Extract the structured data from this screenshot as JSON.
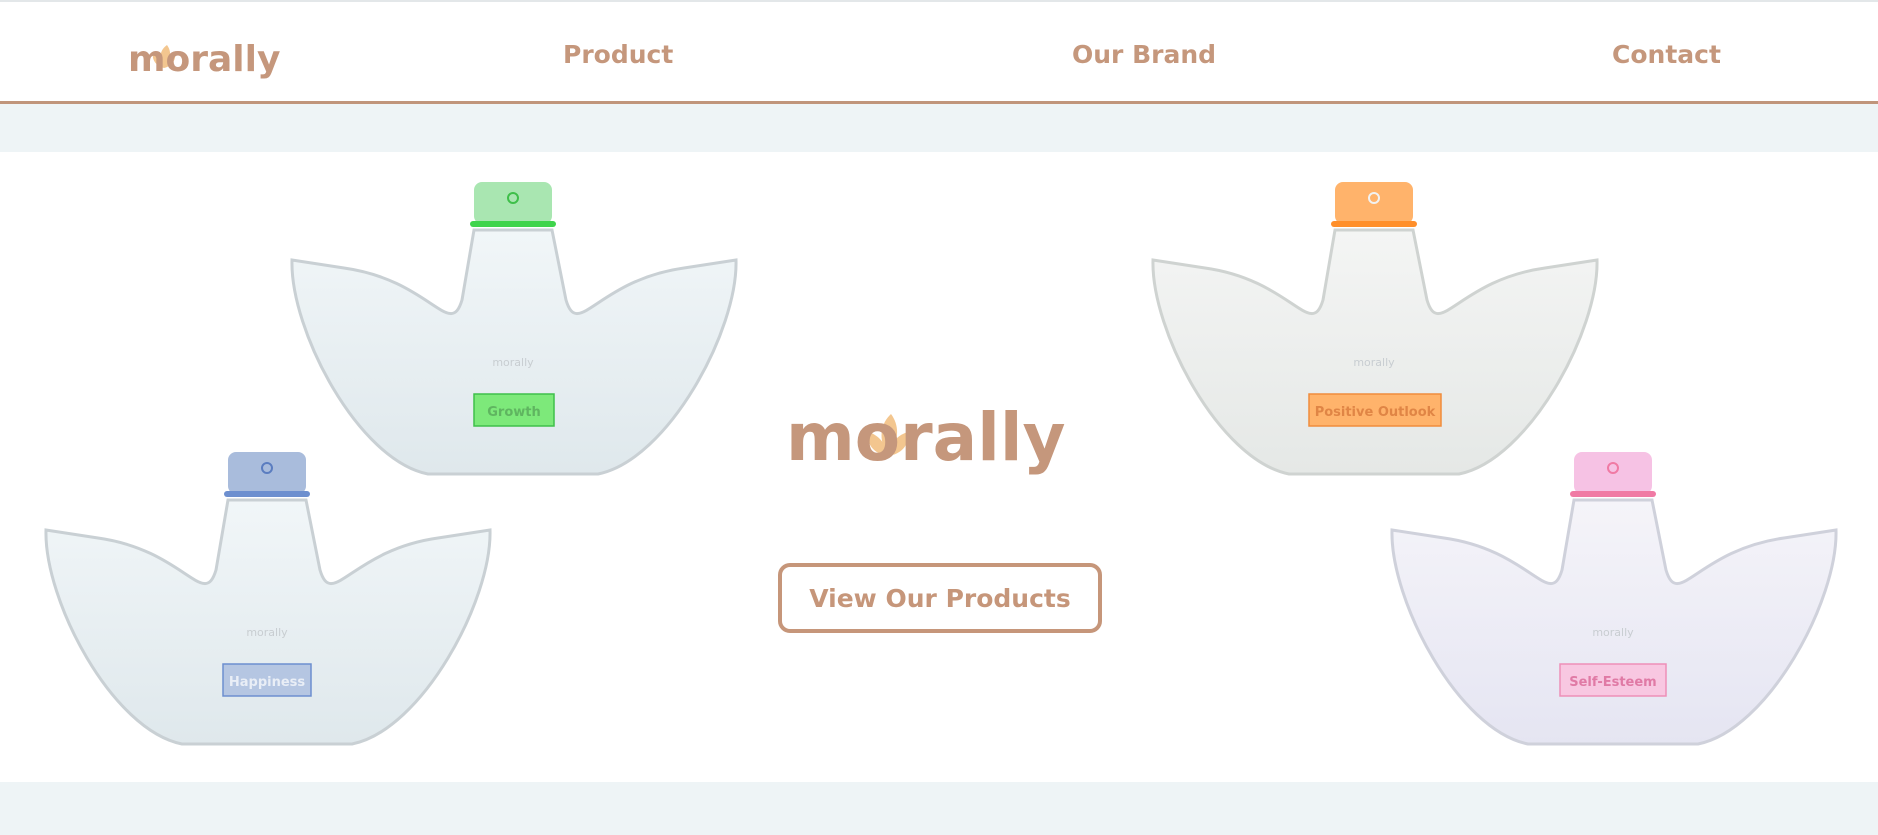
{
  "brand": {
    "logo_text": "morally",
    "accent": "#c5977c",
    "petal_color": "#f3c68f"
  },
  "nav": {
    "items": [
      {
        "label": "Product"
      },
      {
        "label": "Our Brand"
      },
      {
        "label": "Contact"
      }
    ]
  },
  "hero": {
    "cta_label": "View Our Products",
    "bottles": [
      {
        "label": "Growth",
        "brand": "morally",
        "cap_color": "#9fe0a8",
        "band_color": "#3fd44c",
        "label_bg": "#7de97a"
      },
      {
        "label": "Positive Outlook",
        "brand": "morally",
        "cap_color": "#ffb36b",
        "band_color": "#ff8f2a",
        "label_bg": "#ffb36b"
      },
      {
        "label": "Happiness",
        "brand": "morally",
        "cap_color": "#a9bcdc",
        "band_color": "#6d8fcf",
        "label_bg": "#b5c6e2"
      },
      {
        "label": "Self-Esteem",
        "brand": "morally",
        "cap_color": "#f6c2e4",
        "band_color": "#f07aa4",
        "label_bg": "#f8c7e1"
      }
    ]
  }
}
